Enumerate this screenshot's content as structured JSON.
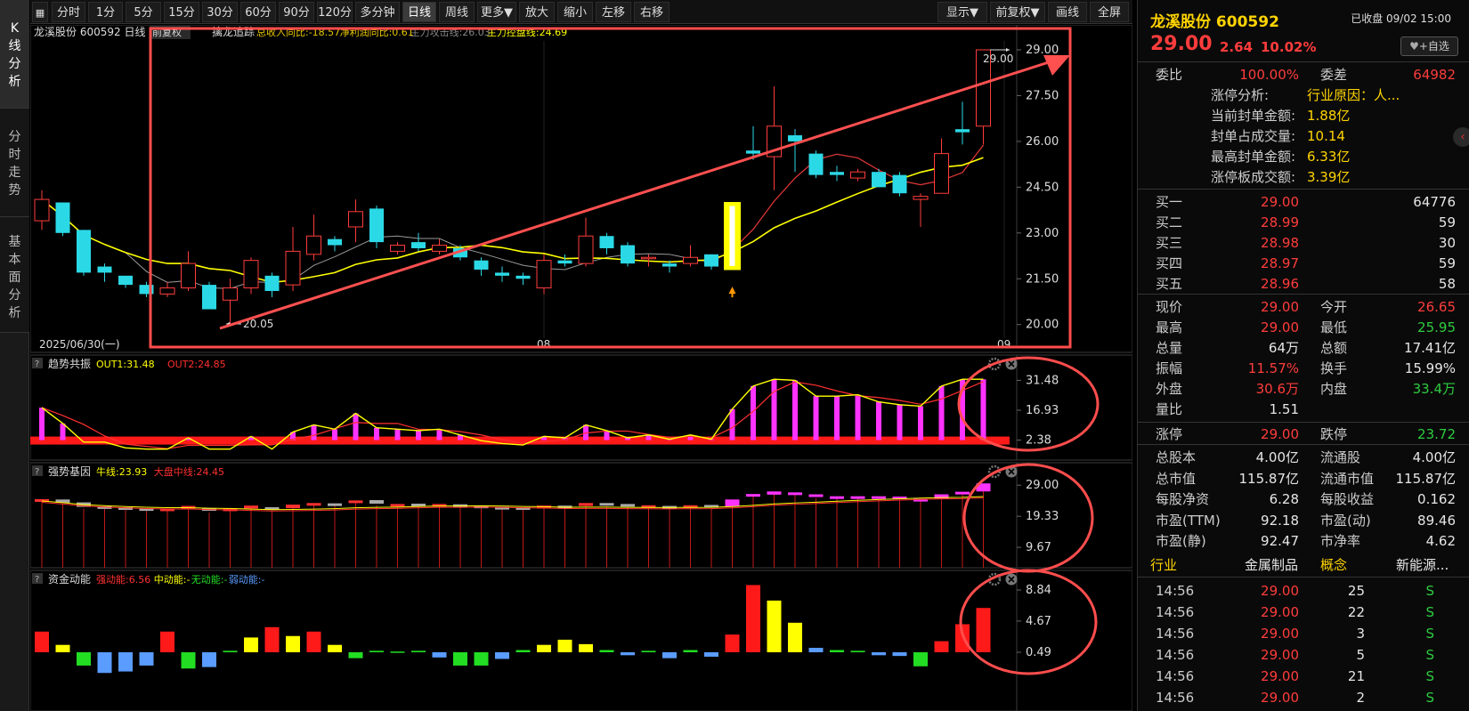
{
  "side_tabs": [
    "K线分析",
    "分时走势",
    "基本面分析"
  ],
  "toolbar": {
    "left_buttons": [
      "分时",
      "1分",
      "5分",
      "15分",
      "30分",
      "60分",
      "90分",
      "120分",
      "多分钟",
      "日线",
      "周线",
      "更多▼",
      "放大",
      "缩小",
      "左移",
      "右移"
    ],
    "right_buttons": [
      "显示▼",
      "前复权▼",
      "画线",
      "全屏"
    ],
    "active": "日线"
  },
  "main_chart": {
    "title": "龙溪股份 600592 日线",
    "adjust": "前复权",
    "indicator_name": "擒龙追踪",
    "legend": [
      "总收入同比:-18.57",
      "净利润同比:0.61",
      "主力攻击线:26.03",
      "主力控盘线:24.69"
    ],
    "legend_colors": [
      "#e8c800",
      "#e8c800",
      "#888888",
      "#ffff00"
    ],
    "y_ticks": [
      "29.00",
      "27.50",
      "26.00",
      "24.50",
      "23.00",
      "21.50",
      "20.00"
    ],
    "y_min": 19.7,
    "y_max": 29.35,
    "x_labels": [
      "2025/06/30(一)",
      "08",
      "09"
    ],
    "high_annotation": "29.00",
    "low_annotation": "20.05"
  },
  "panels": [
    {
      "name": "趋势共振",
      "legend": [
        "OUT1:31.48",
        "OUT2:24.85"
      ],
      "legend_colors": [
        "#ffff00",
        "#ff3030"
      ],
      "y_ticks": [
        "31.48",
        "16.93",
        "2.38"
      ]
    },
    {
      "name": "强势基因",
      "legend": [
        "牛线:23.93",
        "大盘中线:24.45"
      ],
      "legend_colors": [
        "#ffff00",
        "#ff3030"
      ],
      "y_ticks": [
        "29.00",
        "19.33",
        "9.67"
      ]
    },
    {
      "name": "资金动能",
      "legend": [
        "强动能:6.56",
        "中动能:-",
        "无动能:-",
        "弱动能:-"
      ],
      "legend_colors": [
        "#ff3030",
        "#ffff00",
        "#22dd22",
        "#5a9cff"
      ],
      "y_ticks": [
        "8.84",
        "4.67",
        "0.49"
      ]
    }
  ],
  "chart_data": [
    {
      "type": "candlestick",
      "title": "龙溪股份 600592 日线",
      "ylim": [
        19.7,
        29.35
      ],
      "candles": [
        [
          23.4,
          24.1,
          24.4,
          23.1
        ],
        [
          24.0,
          23.0,
          24.0,
          22.9
        ],
        [
          23.1,
          21.7,
          23.1,
          21.6
        ],
        [
          21.9,
          21.7,
          22.0,
          21.4
        ],
        [
          21.6,
          21.3,
          21.6,
          21.2
        ],
        [
          21.3,
          21.0,
          21.4,
          20.9
        ],
        [
          21.0,
          21.2,
          21.4,
          20.9
        ],
        [
          21.2,
          22.0,
          22.4,
          21.1
        ],
        [
          21.3,
          20.5,
          21.4,
          20.5
        ],
        [
          20.8,
          21.2,
          21.5,
          20.0
        ],
        [
          21.2,
          22.1,
          22.2,
          21.0
        ],
        [
          21.6,
          21.1,
          21.7,
          20.9
        ],
        [
          21.3,
          22.4,
          23.2,
          21.1
        ],
        [
          22.3,
          22.9,
          23.6,
          22.1
        ],
        [
          22.8,
          22.6,
          22.9,
          22.4
        ],
        [
          23.2,
          23.7,
          24.1,
          22.7
        ],
        [
          23.8,
          22.7,
          23.9,
          22.5
        ],
        [
          22.4,
          22.6,
          22.7,
          22.3
        ],
        [
          22.7,
          22.5,
          23.0,
          22.4
        ],
        [
          22.4,
          22.6,
          22.8,
          22.3
        ],
        [
          22.5,
          22.2,
          22.6,
          22.1
        ],
        [
          22.1,
          21.8,
          22.2,
          21.6
        ],
        [
          21.7,
          21.6,
          21.9,
          21.4
        ],
        [
          21.6,
          21.5,
          21.7,
          21.3
        ],
        [
          21.2,
          22.1,
          22.3,
          21.0
        ],
        [
          22.1,
          22.0,
          22.3,
          21.9
        ],
        [
          22.0,
          22.9,
          23.5,
          21.9
        ],
        [
          22.9,
          22.5,
          23.0,
          22.3
        ],
        [
          22.6,
          22.0,
          22.7,
          21.9
        ],
        [
          22.2,
          22.2,
          22.3,
          21.9
        ],
        [
          22.0,
          21.9,
          22.1,
          21.7
        ],
        [
          22.0,
          22.2,
          22.6,
          21.9
        ],
        [
          22.3,
          21.9,
          22.3,
          21.8
        ],
        [
          21.8,
          24.0,
          24.0,
          21.8
        ],
        [
          25.7,
          25.6,
          26.5,
          25.4
        ],
        [
          25.5,
          26.5,
          27.8,
          24.4
        ],
        [
          26.2,
          26.0,
          26.4,
          25.0
        ],
        [
          25.6,
          24.9,
          25.7,
          24.8
        ],
        [
          25.0,
          24.9,
          25.2,
          24.7
        ],
        [
          24.8,
          25.0,
          25.1,
          24.7
        ],
        [
          25.0,
          24.5,
          25.1,
          24.5
        ],
        [
          24.9,
          24.3,
          25.0,
          24.2
        ],
        [
          24.1,
          24.2,
          24.3,
          23.2
        ],
        [
          24.3,
          25.6,
          26.1,
          24.3
        ],
        [
          26.4,
          26.3,
          27.3,
          25.9
        ],
        [
          26.5,
          29.0,
          29.0,
          25.9
        ]
      ]
    }
  ],
  "right_panel": {
    "name": "龙溪股份",
    "code": "600592",
    "status": "已收盘 09/02 15:00",
    "price": "29.00",
    "change": "2.64",
    "change_pct": "10.02%",
    "add_watch": "+自选",
    "weibi_label": "委比",
    "weibi": "100.00%",
    "weicha_label": "委差",
    "weicha": "64982",
    "limit_info": [
      {
        "label": "涨停分析:",
        "value": "行业原因：人..."
      },
      {
        "label": "当前封单金额:",
        "value": "1.88亿"
      },
      {
        "label": "封单占成交量:",
        "value": "10.14"
      },
      {
        "label": "最高封单金额:",
        "value": "6.33亿"
      },
      {
        "label": "涨停板成交额:",
        "value": "3.39亿"
      }
    ],
    "buy_book": [
      {
        "label": "买一",
        "price": "29.00",
        "vol": "64776"
      },
      {
        "label": "买二",
        "price": "28.99",
        "vol": "59"
      },
      {
        "label": "买三",
        "price": "28.98",
        "vol": "30"
      },
      {
        "label": "买四",
        "price": "28.97",
        "vol": "59"
      },
      {
        "label": "买五",
        "price": "28.96",
        "vol": "58"
      }
    ],
    "stats": [
      {
        "l1": "现价",
        "v1": "29.00",
        "c1": "red",
        "l2": "今开",
        "v2": "26.65",
        "c2": "red"
      },
      {
        "l1": "最高",
        "v1": "29.00",
        "c1": "red",
        "l2": "最低",
        "v2": "25.95",
        "c2": "green"
      },
      {
        "l1": "总量",
        "v1": "64万",
        "c1": "white",
        "l2": "总额",
        "v2": "17.41亿",
        "c2": "white"
      },
      {
        "l1": "振幅",
        "v1": "11.57%",
        "c1": "red",
        "l2": "换手",
        "v2": "15.99%",
        "c2": "white"
      },
      {
        "l1": "外盘",
        "v1": "30.6万",
        "c1": "red",
        "l2": "内盘",
        "v2": "33.4万",
        "c2": "green"
      },
      {
        "l1": "量比",
        "v1": "1.51",
        "c1": "white",
        "l2": "",
        "v2": "",
        "c2": "white"
      }
    ],
    "limits": {
      "up_label": "涨停",
      "up": "29.00",
      "down_label": "跌停",
      "down": "23.72"
    },
    "fundamentals": [
      {
        "l1": "总股本",
        "v1": "4.00亿",
        "l2": "流通股",
        "v2": "4.00亿"
      },
      {
        "l1": "总市值",
        "v1": "115.87亿",
        "l2": "流通市值",
        "v2": "115.87亿"
      },
      {
        "l1": "每股净资",
        "v1": "6.28",
        "l2": "每股收益",
        "v2": "0.162"
      },
      {
        "l1": "市盈(TTM)",
        "v1": "92.18",
        "l2": "市盈(动)",
        "v2": "89.46"
      },
      {
        "l1": "市盈(静)",
        "v1": "92.47",
        "l2": "市净率",
        "v2": "4.62"
      }
    ],
    "category": {
      "industry_label": "行业",
      "industry": "金属制品",
      "concept_label": "概念",
      "concept": "新能源..."
    },
    "trades": [
      {
        "time": "14:56",
        "price": "29.00",
        "vol": "25",
        "side": "S"
      },
      {
        "time": "14:56",
        "price": "29.00",
        "vol": "22",
        "side": "S"
      },
      {
        "time": "14:56",
        "price": "29.00",
        "vol": "3",
        "side": "S"
      },
      {
        "time": "14:56",
        "price": "29.00",
        "vol": "5",
        "side": "S"
      },
      {
        "time": "14:56",
        "price": "29.00",
        "vol": "21",
        "side": "S"
      },
      {
        "time": "14:56",
        "price": "29.00",
        "vol": "2",
        "side": "S"
      }
    ]
  }
}
